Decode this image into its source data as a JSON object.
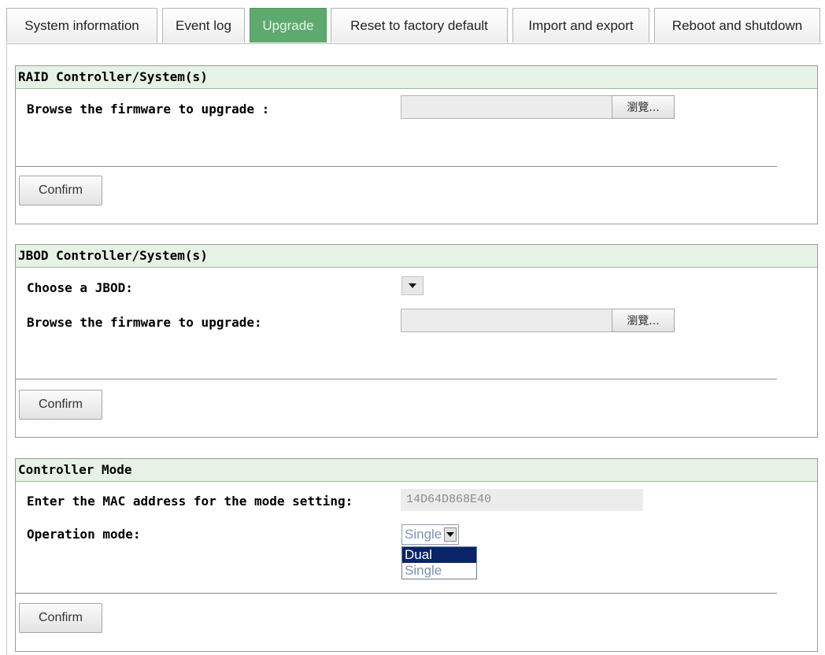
{
  "tabs": [
    {
      "label": "System information"
    },
    {
      "label": "Event log"
    },
    {
      "label": "Upgrade"
    },
    {
      "label": "Reset to factory default"
    },
    {
      "label": "Import and export"
    },
    {
      "label": "Reboot and shutdown"
    }
  ],
  "active_tab": "Upgrade",
  "raid": {
    "title": "RAID Controller/System(s)",
    "browse_label": "Browse the firmware to upgrade :",
    "file_value": "",
    "browse_button": "瀏覽...",
    "confirm": "Confirm"
  },
  "jbod": {
    "title": "JBOD Controller/System(s)",
    "choose_label": "Choose a JBOD:",
    "choose_value": "",
    "browse_label": "Browse the firmware to upgrade:",
    "file_value": "",
    "browse_button": "瀏覽...",
    "confirm": "Confirm"
  },
  "mode": {
    "title": "Controller Mode",
    "mac_label": "Enter the MAC address for the mode setting:",
    "mac_value": "14D64D868E40",
    "op_label": "Operation mode:",
    "op_selected": "Single",
    "op_options": [
      "Dual",
      "Single"
    ],
    "op_highlighted": "Dual",
    "confirm": "Confirm"
  },
  "colors": {
    "active_tab": "#5eaa6e",
    "section_header": "#e6f2e6",
    "option_highlight": "#0a246a"
  }
}
